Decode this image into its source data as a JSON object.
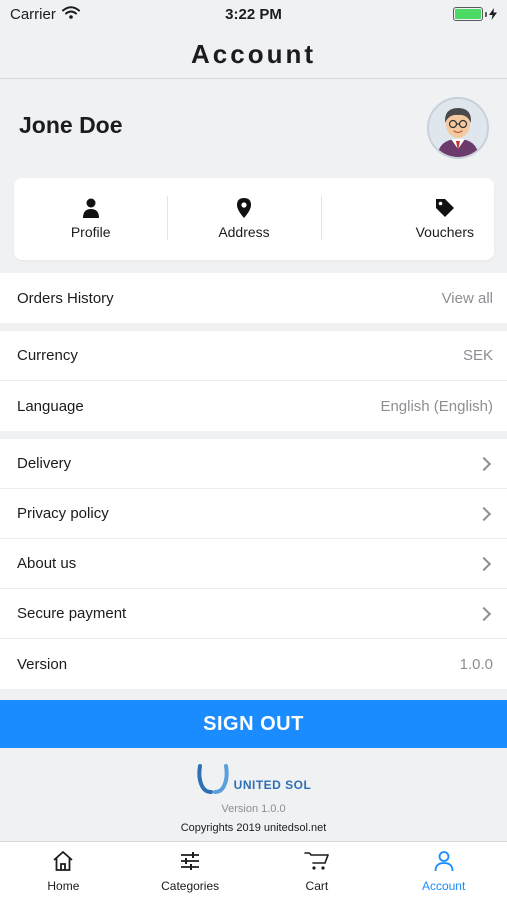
{
  "status_bar": {
    "carrier": "Carrier",
    "time": "3:22 PM"
  },
  "header": {
    "title": "Account"
  },
  "user": {
    "name": "Jone Doe"
  },
  "quick_actions": [
    {
      "label": "Profile",
      "icon": "person-icon"
    },
    {
      "label": "Address",
      "icon": "location-pin-icon"
    },
    {
      "label": "Vouchers",
      "icon": "tag-icon"
    }
  ],
  "orders": {
    "label": "Orders History",
    "action": "View all"
  },
  "settings": [
    {
      "label": "Currency",
      "value": "SEK"
    },
    {
      "label": "Language",
      "value": "English (English)"
    }
  ],
  "info_links": [
    {
      "label": "Delivery"
    },
    {
      "label": "Privacy policy"
    },
    {
      "label": "About us"
    },
    {
      "label": "Secure payment"
    },
    {
      "label": "Version",
      "value": "1.0.0"
    }
  ],
  "signout": {
    "label": "SIGN OUT"
  },
  "footer": {
    "brand": "UNITED SOL",
    "version": "Version 1.0.0",
    "copyright": "Copyrights 2019 unitedsol.net"
  },
  "tabs": [
    {
      "label": "Home",
      "icon": "home-icon",
      "active": false
    },
    {
      "label": "Categories",
      "icon": "sliders-icon",
      "active": false
    },
    {
      "label": "Cart",
      "icon": "cart-icon",
      "active": false
    },
    {
      "label": "Account",
      "icon": "person-outline-icon",
      "active": true
    }
  ],
  "colors": {
    "accent": "#1a8cff",
    "background": "#eff1f3",
    "battery": "#4cd964",
    "brand": "#2f6fb6"
  }
}
